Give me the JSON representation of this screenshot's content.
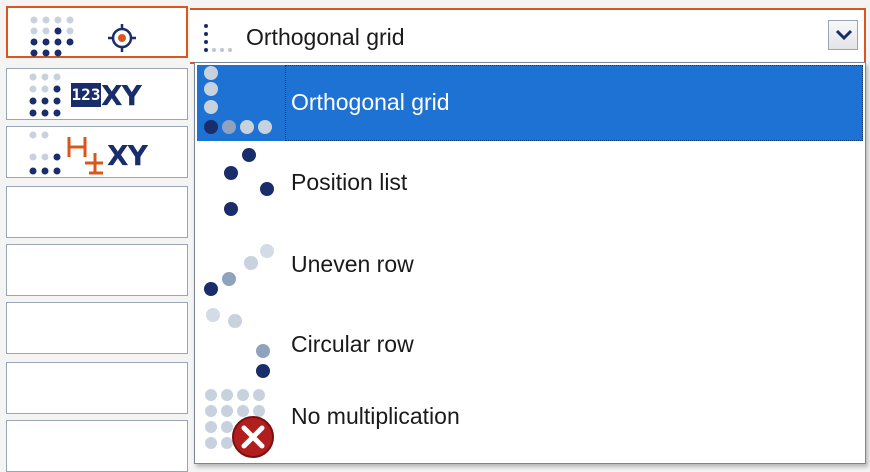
{
  "combo": {
    "selected_label": "Orthogonal grid"
  },
  "left_panel": {
    "items": [
      {
        "name": "target",
        "label": ""
      },
      {
        "name": "numbered",
        "label": "XY"
      },
      {
        "name": "dimension",
        "label": "XY"
      }
    ],
    "numbered_badge": "123"
  },
  "dropdown": {
    "options": [
      {
        "label": "Orthogonal grid",
        "selected": true
      },
      {
        "label": "Position list",
        "selected": false
      },
      {
        "label": "Uneven row",
        "selected": false
      },
      {
        "label": "Circular row",
        "selected": false
      },
      {
        "label": "No multiplication",
        "selected": false
      }
    ]
  },
  "colors": {
    "accent_orange": "#d9571f",
    "dot_dark": "#1a2d6b",
    "dot_light": "#b9c6d8",
    "selection_blue": "#1d72d4",
    "cancel_red": "#b01e1e"
  }
}
